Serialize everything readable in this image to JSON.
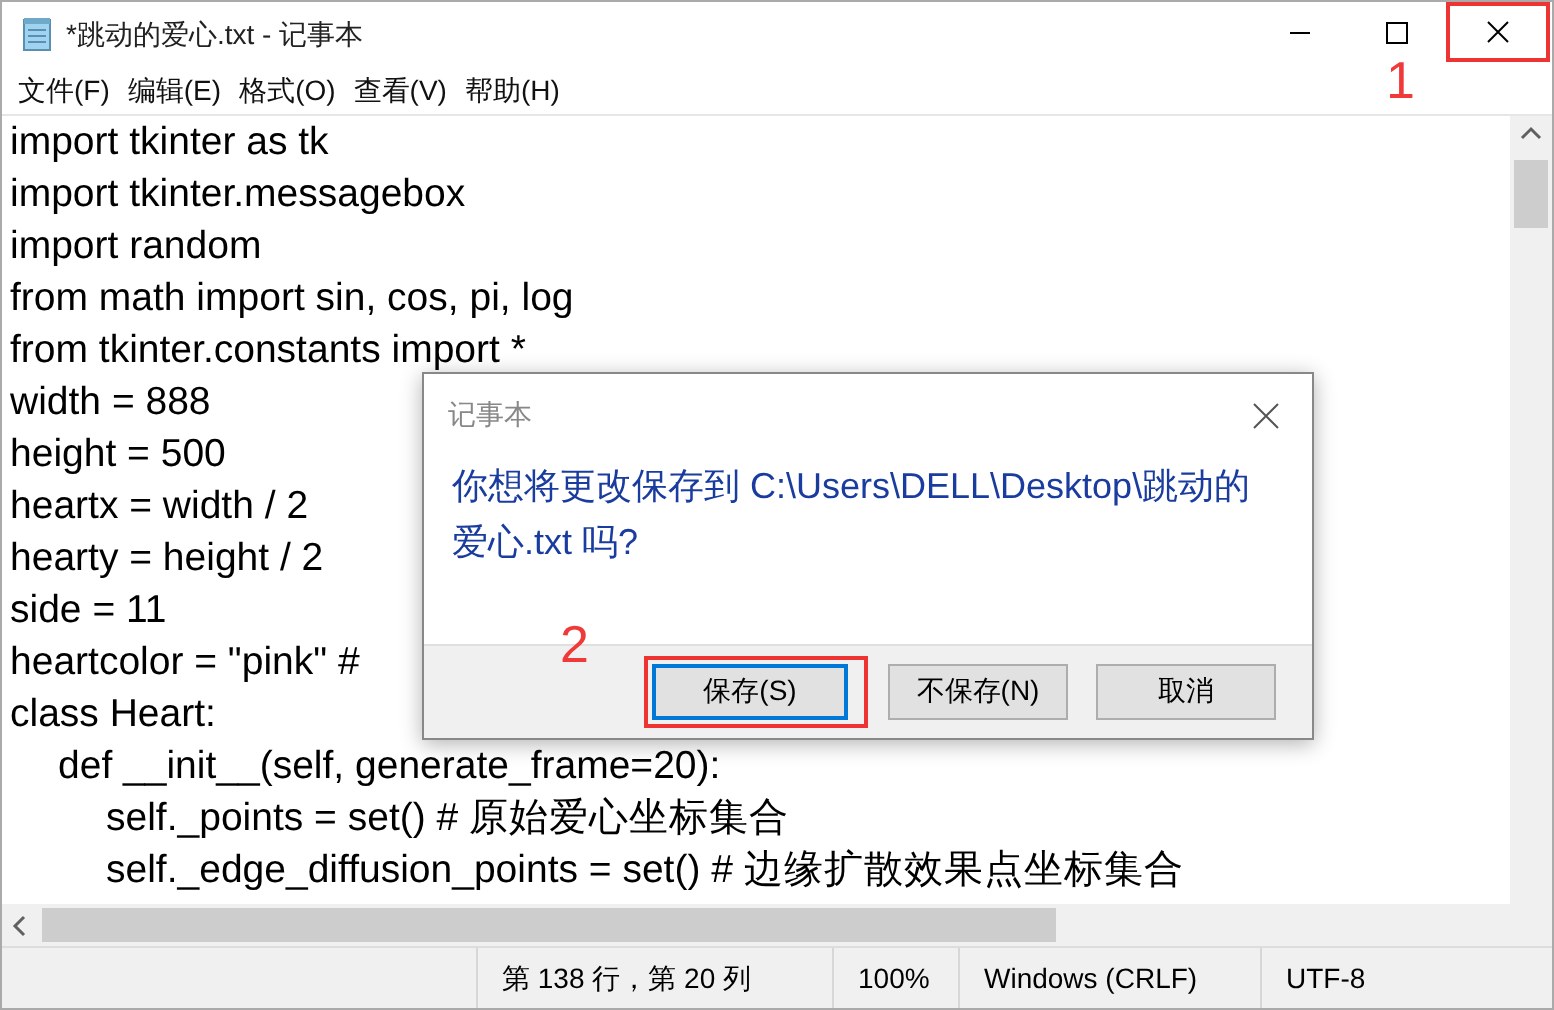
{
  "window": {
    "title": "*跳动的爱心.txt - 记事本",
    "close_highlighted": true,
    "annotation": "1"
  },
  "menu": [
    "文件(F)",
    "编辑(E)",
    "格式(O)",
    "查看(V)",
    "帮助(H)"
  ],
  "code": [
    {
      "text": "import tkinter as tk"
    },
    {
      "text": "import tkinter.messagebox"
    },
    {
      "text": "import random"
    },
    {
      "text": "from math import sin, cos, pi, log"
    },
    {
      "text": "from tkinter.constants import *"
    },
    {
      "text": "width = 888"
    },
    {
      "text": "height = 500"
    },
    {
      "text": "heartx = width / 2"
    },
    {
      "text": "hearty = height / 2"
    },
    {
      "text": "side = 11"
    },
    {
      "text": "heartcolor = \"pink\"  #"
    },
    {
      "text": "class Heart:",
      "children": [
        {
          "text": "def __init__(self, generate_frame=20):",
          "children": [
            {
              "text": "self._points = set()  # 原始爱心坐标集合"
            },
            {
              "text": "self._edge_diffusion_points = set()  # 边缘扩散效果点坐标集合"
            }
          ]
        }
      ]
    }
  ],
  "dialog": {
    "title": "记事本",
    "message": "你想将更改保存到 C:\\Users\\DELL\\Desktop\\跳动的爱心.txt 吗?",
    "annotation": "2",
    "buttons": [
      {
        "label": "保存(S)",
        "focused": true,
        "highlighted": true
      },
      {
        "label": "不保存(N)",
        "focused": false,
        "highlighted": false
      },
      {
        "label": "取消",
        "focused": false,
        "highlighted": false
      }
    ]
  },
  "status_bar": [
    "第 138 行，第 20 列",
    "100%",
    "Windows (CRLF)",
    "UTF-8"
  ]
}
